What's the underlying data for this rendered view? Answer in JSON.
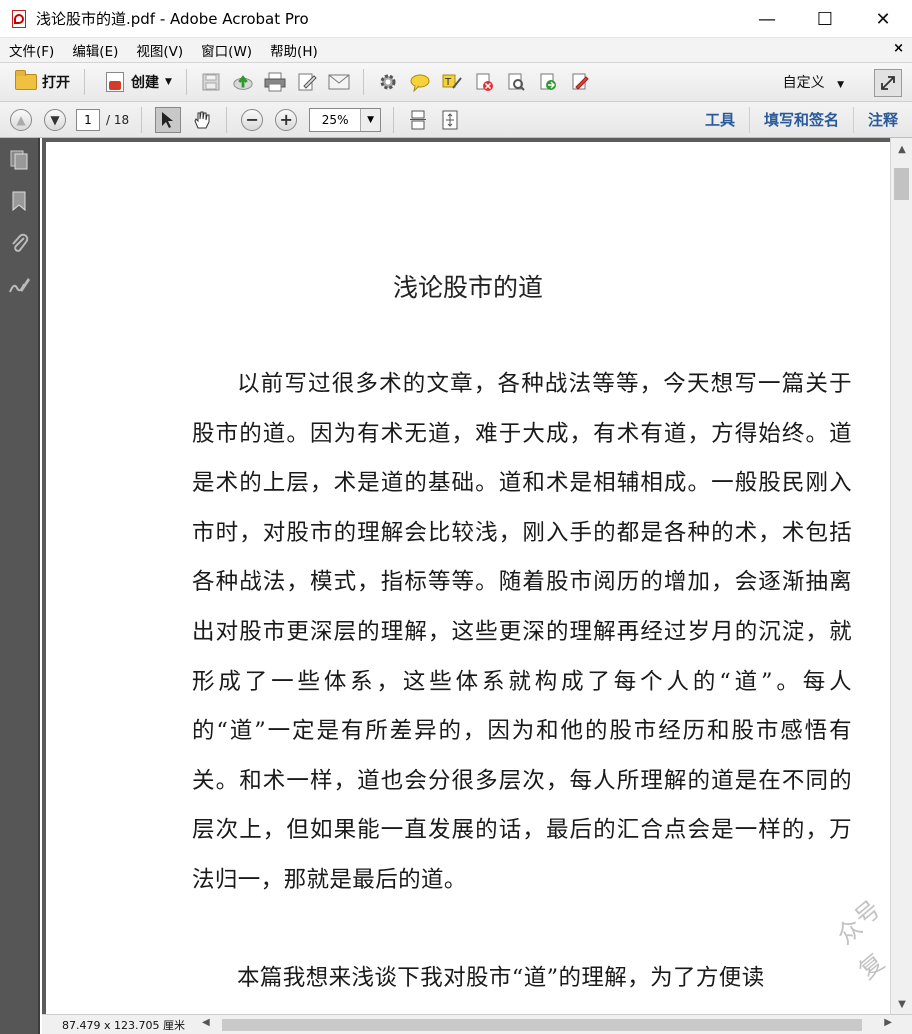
{
  "window": {
    "title": "浅论股市的道.pdf - Adobe Acrobat Pro",
    "minimize": "—",
    "maximize": "☐",
    "close": "✕"
  },
  "menu": {
    "items": [
      "文件(F)",
      "编辑(E)",
      "视图(V)",
      "窗口(W)",
      "帮助(H)"
    ],
    "close": "×"
  },
  "toolbar1": {
    "open_label": "打开",
    "create_label": "创建",
    "customize_label": "自定义"
  },
  "toolbar2": {
    "page_current": "1",
    "page_total": "/ 18",
    "zoom": "25%",
    "tools_label": "工具",
    "fill_sign_label": "填写和签名",
    "comment_label": "注释"
  },
  "document": {
    "title": "浅论股市的道",
    "paragraph1": "以前写过很多术的文章，各种战法等等，今天想写一篇关于股市的道。因为有术无道，难于大成，有术有道，方得始终。道是术的上层，术是道的基础。道和术是相辅相成。一般股民刚入市时，对股市的理解会比较浅，刚入手的都是各种的术，术包括各种战法，模式，指标等等。随着股市阅历的增加，会逐渐抽离出对股市更深层的理解，这些更深的理解再经过岁月的沉淀，就形成了一些体系，这些体系就构成了每个人的“道”。每人的“道”一定是有所差异的，因为和他的股市经历和股市感悟有关。和术一样，道也会分很多层次，每人所理解的道是在不同的层次上，但如果能一直发展的话，最后的汇合点会是一样的，万法归一，那就是最后的道。",
    "paragraph2": "本篇我想来浅谈下我对股市“道”的理解，为了方便读",
    "watermark_chars": [
      "众",
      "号",
      "复"
    ]
  },
  "statusbar": {
    "dimensions": "87.479 x 123.705 厘米"
  }
}
